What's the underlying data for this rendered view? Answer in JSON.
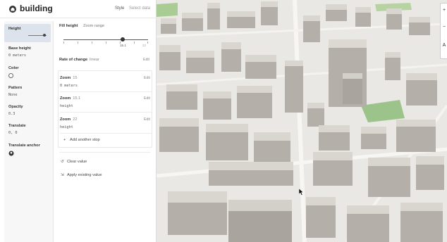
{
  "header": {
    "layer_name": "building",
    "tabs": [
      "Style",
      "Select data"
    ]
  },
  "properties": [
    {
      "label": "Height",
      "value": ""
    },
    {
      "label": "Base height",
      "value": "0 meters"
    },
    {
      "label": "Color",
      "value": ""
    },
    {
      "label": "Pattern",
      "value": "None"
    },
    {
      "label": "Opacity",
      "value": "0.3"
    },
    {
      "label": "Translate",
      "value": "0, 0"
    },
    {
      "label": "Translate anchor",
      "value": ""
    }
  ],
  "detail": {
    "fill_height_label": "Fill height",
    "zoom_range_label": "Zoom range",
    "slider_readout": "15.1",
    "slider_end": "22",
    "slider_position": 0.7,
    "rate_of_change_label": "Rate of change",
    "rate_of_change_value": "linear",
    "edit_label": "Edit",
    "zoom_stops": [
      {
        "title": "Zoom",
        "zoom": "15",
        "value": "0 meters"
      },
      {
        "title": "Zoom",
        "zoom": "15.1",
        "value": "height"
      },
      {
        "title": "Zoom",
        "zoom": "22",
        "value": "height"
      }
    ],
    "add_stop_label": "Add another stop",
    "clear_value_label": "Clear value",
    "apply_existing_label": "Apply existing value"
  },
  "map_controls": [
    "+",
    "−",
    "A"
  ],
  "colors": {
    "panel_bg": "#ffffff",
    "selected_property_bg": "#dde3ec",
    "map_ground": "#e9e8e4",
    "building_roof": "#d9d5cf",
    "building_side": "#b4afa8",
    "park": "#9cc48a"
  },
  "icons": [
    "layer-icon",
    "cursor-icon",
    "undo-icon",
    "apply-icon",
    "plus-icon",
    "anchor-icon"
  ]
}
